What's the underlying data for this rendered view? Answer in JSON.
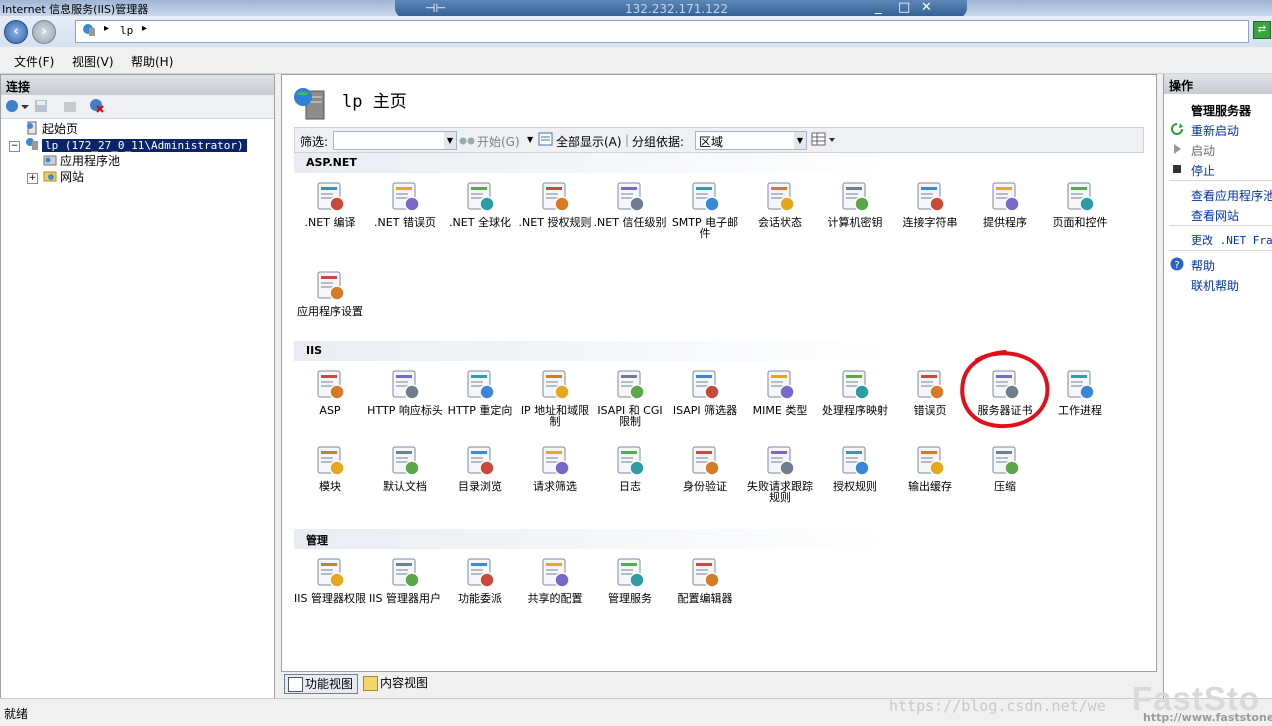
{
  "window": {
    "title": "Internet 信息服务(IIS)管理器",
    "remote_ip": "132.232.171.122",
    "rdp_controls": [
      "_",
      "□",
      "✕"
    ]
  },
  "address": {
    "path": "lp"
  },
  "menu": [
    "文件(F)",
    "视图(V)",
    "帮助(H)"
  ],
  "connections": {
    "header": "连接",
    "tree": [
      {
        "label": "起始页"
      },
      {
        "label": "lp (172_27_0_11\\Administrator)",
        "selected": true
      },
      {
        "label": "应用程序池"
      },
      {
        "label": "网站"
      }
    ]
  },
  "center": {
    "title": "lp 主页",
    "filter": {
      "label": "筛选:",
      "start": "开始(G)",
      "show_all": "全部显示(A)",
      "group_label": "分组依据:",
      "group_value": "区域"
    },
    "sections": [
      {
        "title": "ASP.NET",
        "items": [
          ".NET 编译",
          ".NET 错误页",
          ".NET 全球化",
          ".NET 授权规则",
          ".NET 信任级别",
          "SMTP 电子邮件",
          "会话状态",
          "计算机密钥",
          "连接字符串",
          "提供程序",
          "页面和控件",
          "应用程序设置"
        ]
      },
      {
        "title": "IIS",
        "items": [
          "ASP",
          "HTTP 响应标头",
          "HTTP 重定向",
          "IP 地址和域限制",
          "ISAPI 和 CGI 限制",
          "ISAPI 筛选器",
          "MIME 类型",
          "处理程序映射",
          "错误页",
          "服务器证书",
          "工作进程",
          "模块",
          "默认文档",
          "目录浏览",
          "请求筛选",
          "日志",
          "身份验证",
          "失败请求跟踪规则",
          "授权规则",
          "输出缓存",
          "压缩"
        ]
      },
      {
        "title": "管理",
        "items": [
          "IIS 管理器权限",
          "IIS 管理器用户",
          "功能委派",
          "共享的配置",
          "管理服务",
          "配置编辑器"
        ]
      }
    ],
    "view_tabs": [
      "功能视图",
      "内容视图"
    ]
  },
  "actions": {
    "header": "操作",
    "group": "管理服务器",
    "restart": "重新启动",
    "start": "启动",
    "stop": "停止",
    "view_pools": "查看应用程序池",
    "view_sites": "查看网站",
    "change_net": "更改 .NET Fram",
    "help": "帮助",
    "online_help": "联机帮助"
  },
  "status": {
    "text": "就绪"
  },
  "watermark": {
    "blog": "https://blog.csdn.net/we",
    "brand": "FastSto",
    "brand_url": "http://www.faststone"
  },
  "colors": {
    "annotation_circle": "#e0101a",
    "selection": "#0a246a",
    "link": "#0033a8"
  }
}
